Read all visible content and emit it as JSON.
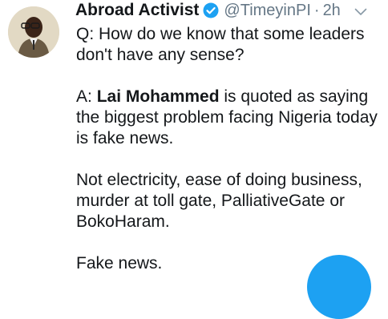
{
  "tweet": {
    "display_name": "Abroad Activist",
    "handle": "@TimeyinPI",
    "separator": "·",
    "timestamp": "2h",
    "question": "Q: How do we know that some leaders don't have any sense?",
    "answer_prefix": "A: ",
    "answer_name": "Lai Mohammed",
    "answer_rest": " is quoted as saying the biggest problem facing Nigeria today is fake news.",
    "paragraph_three": "Not electricity, ease of doing business, murder at toll gate, PalliativeGate or BokoHaram.",
    "paragraph_four": "Fake news."
  },
  "icons": {
    "verified": "verified-badge-icon",
    "caret": "chevron-down-icon",
    "compose": "compose-tweet-button"
  },
  "colors": {
    "text": "#14171a",
    "secondary": "#657786",
    "accent": "#1da1f2"
  }
}
